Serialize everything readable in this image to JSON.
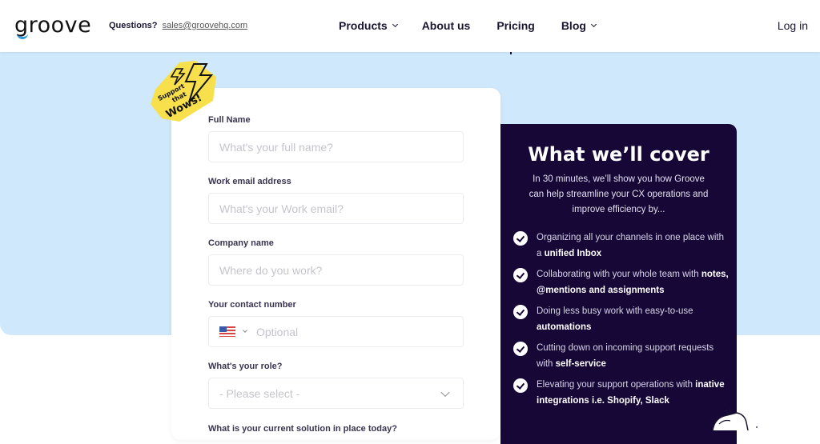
{
  "header": {
    "logo": "groove",
    "questions_label": "Questions?",
    "questions_email": "sales@groovehq.com",
    "nav": [
      {
        "label": "Products",
        "has_dropdown": true
      },
      {
        "label": "About us",
        "has_dropdown": false
      },
      {
        "label": "Pricing",
        "has_dropdown": false
      },
      {
        "label": "Blog",
        "has_dropdown": true
      }
    ],
    "login": "Log in"
  },
  "sticker": {
    "line1": "Support",
    "line2": "that",
    "line3": "Wows!",
    "color": "#f7e04b"
  },
  "form": {
    "fields": [
      {
        "label": "Full Name",
        "placeholder": "What's your full name?"
      },
      {
        "label": "Work email address",
        "placeholder": "What's your Work email?"
      },
      {
        "label": "Company name",
        "placeholder": "Where do you work?"
      },
      {
        "label": "Your contact number",
        "placeholder": "Optional",
        "country": "US"
      },
      {
        "label": "What's your role?",
        "placeholder": "- Please select -"
      }
    ],
    "next_label_cut": "What is your current solution in place today?"
  },
  "panel": {
    "title": "What we’ll cover",
    "intro": "In 30 minutes, we’ll show you how Groove can help streamline your CX operations and improve efficiency by...",
    "items": [
      {
        "text": "Organizing all your channels in one place with a ",
        "bold": "unified Inbox"
      },
      {
        "text": "Collaborating with your whole team with ",
        "bold": "notes, @mentions and assignments"
      },
      {
        "text": "Doing less busy work with easy-to-use ",
        "bold": "automations"
      },
      {
        "text": "Cutting down on incoming support requests with ",
        "bold": "self-service"
      },
      {
        "text": "Elevating your support operations with ",
        "bold": "inative integrations i.e. Shopify, Slack"
      }
    ]
  },
  "colors": {
    "hero_bg": "#cfe8fc",
    "panel_bg": "#160737",
    "logo_accent": "#2d9cdb"
  }
}
